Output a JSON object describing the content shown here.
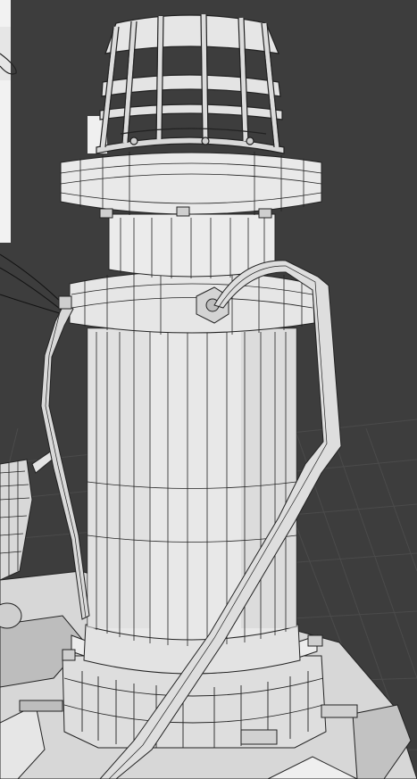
{
  "viewport": {
    "background_color": "#3d3d3d",
    "grid_color": "#4a4a4a",
    "shaded_surface_color": "#e8e8e8",
    "shadow_surface_color": "#c9c9c9",
    "wire_color": "#1a1a1a",
    "reference_panel_color": "#f2f2f2"
  },
  "model": {
    "view_mode": "wireframe-on-shaded",
    "components": [
      "top-cage",
      "top-flange",
      "neck",
      "upper-collar",
      "main-cylinder",
      "cable-conduit",
      "base-collar",
      "base-plate",
      "side-hose"
    ]
  }
}
